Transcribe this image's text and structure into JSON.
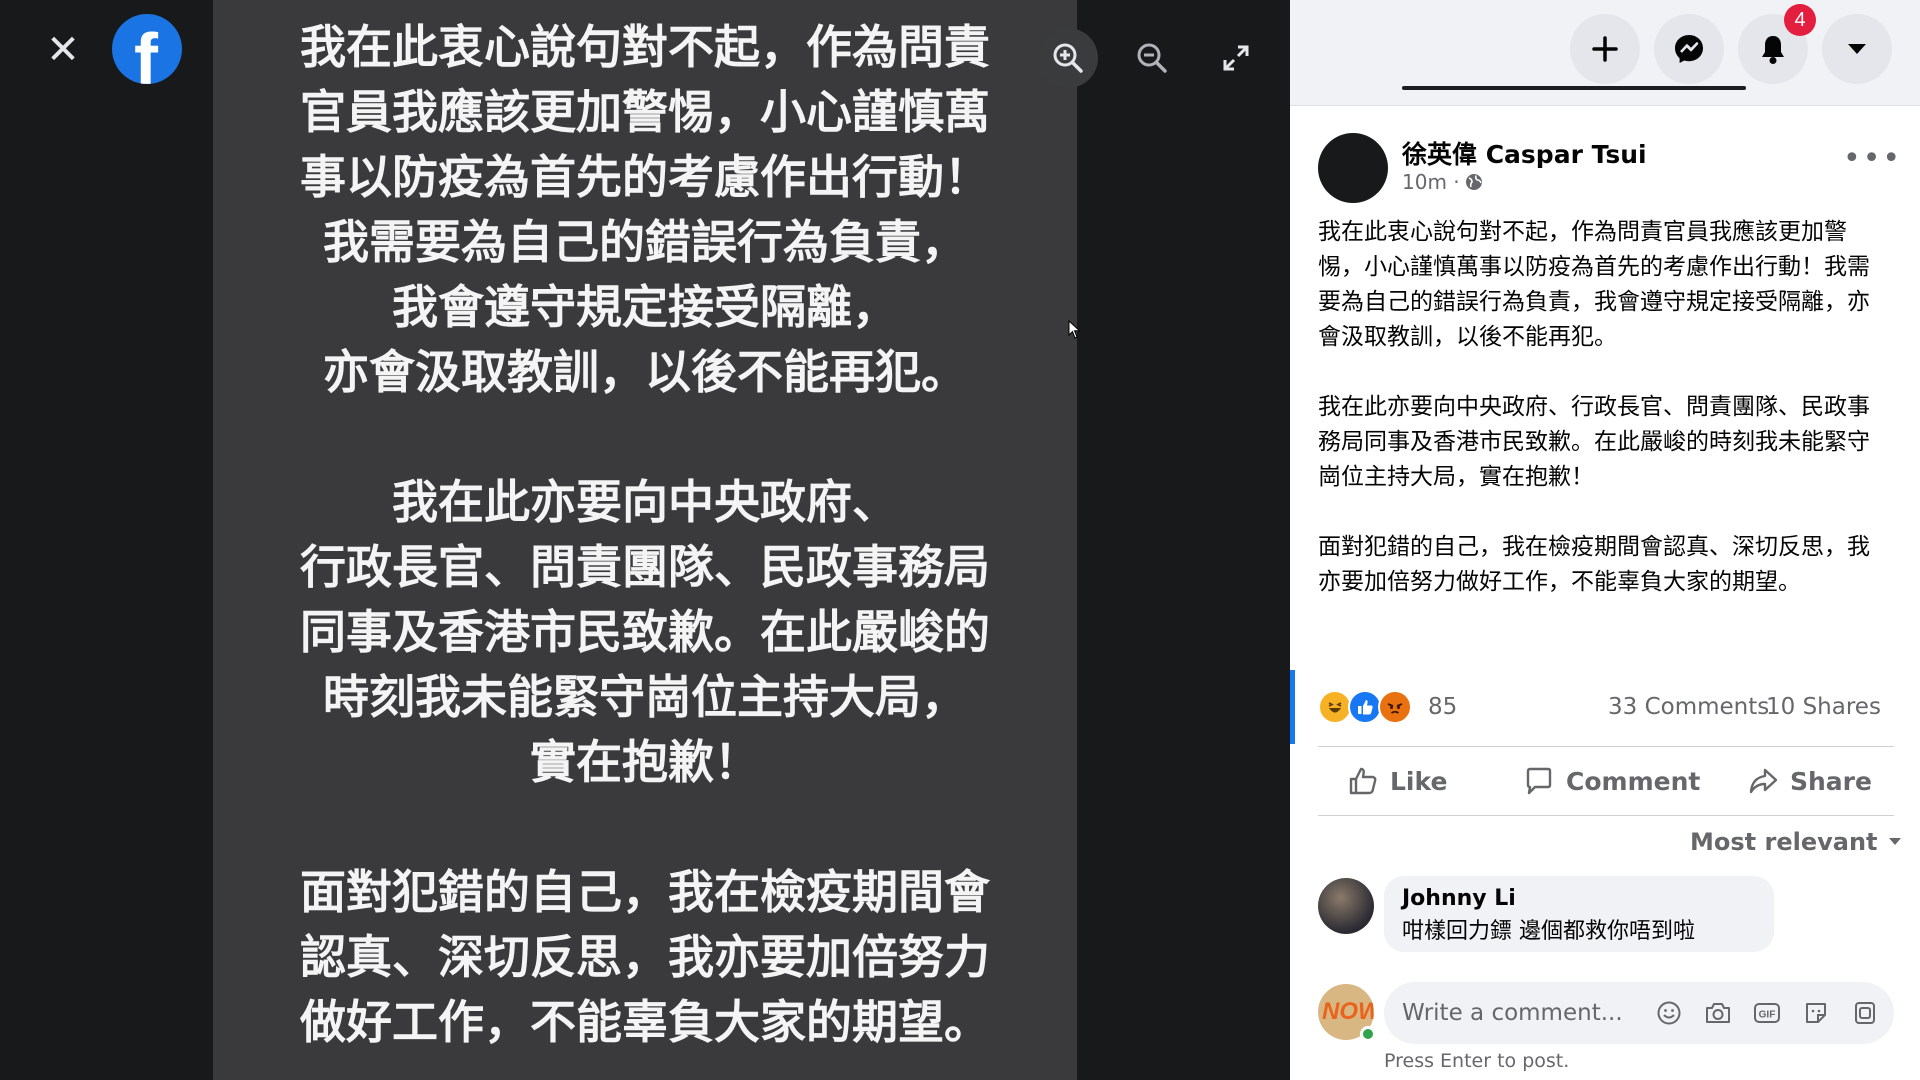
{
  "viewer": {
    "close_glyph": "✕",
    "logo_letter": "f",
    "photo_lines": [
      "我在此衷心說句對不起，作為問責",
      "官員我應該更加警惕，小心謹慎萬",
      "事以防疫為首先的考慮作出行動！",
      "我需要為自己的錯誤行為負責，",
      "我會遵守規定接受隔離，",
      "亦會汲取教訓，以後不能再犯。",
      "",
      "我在此亦要向中央政府、",
      "行政長官、問責團隊、民政事務局",
      "同事及香港市民致歉。在此嚴峻的",
      "時刻我未能緊守崗位主持大局，",
      "實在抱歉！",
      "",
      "面對犯錯的自己，我在檢疫期間會",
      "認真、深切反思，我亦要加倍努力",
      "做好工作，不能辜負大家的期望。"
    ]
  },
  "header": {
    "notifications_count": "4"
  },
  "post": {
    "author": "徐英偉 Caspar Tsui",
    "time": "10m ·",
    "audience_icon": "globe-icon",
    "paragraphs": [
      "我在此衷心說句對不起，作為問責官員我應該更加警惕，小心謹慎萬事以防疫為首先的考慮作出行動！我需要為自己的錯誤行為負責，我會遵守規定接受隔離，亦會汲取教訓，以後不能再犯。",
      "我在此亦要向中央政府、行政長官、問責團隊、民政事務局同事及香港市民致歉。在此嚴峻的時刻我未能緊守崗位主持大局，實在抱歉！",
      "面對犯錯的自己，我在檢疫期間會認真、深切反思，我亦要加倍努力做好工作，不能辜負大家的期望。"
    ],
    "reaction_count": "85",
    "comments_label": "33 Comments",
    "shares_label": "10 Shares",
    "actions": {
      "like": "Like",
      "comment": "Comment",
      "share": "Share"
    },
    "sort_label": "Most relevant",
    "comments": [
      {
        "name": "Johnny Li",
        "text": "咁樣回力鏢 邊個都救你唔到啦"
      }
    ],
    "write_placeholder": "Write a comment...",
    "enter_hint": "Press Enter to post."
  },
  "colors": {
    "accent": "#1877f2",
    "badge": "#e41e3f",
    "viewer_bg": "#18191a",
    "photo_bg": "#3a3a3d"
  }
}
